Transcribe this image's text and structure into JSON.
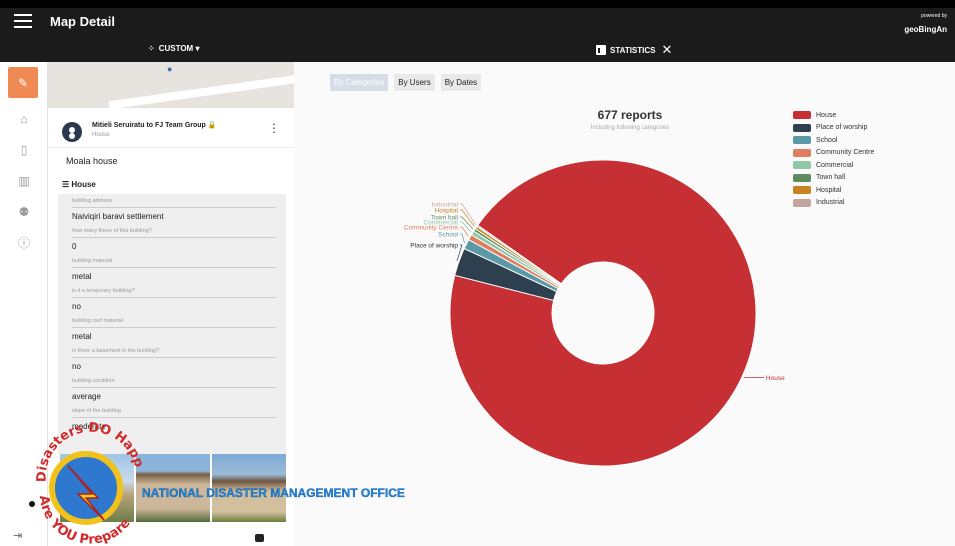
{
  "header": {
    "title": "Map Detail",
    "powered_by": "powered by",
    "brand": "geoBingAn"
  },
  "subbar": {
    "custom_label": "CUSTOM",
    "statistics_label": "STATISTICS"
  },
  "report": {
    "author": "Mitieli Seruiratu to FJ Team Group",
    "subtitle": "House",
    "title": "Moala house",
    "category": "House",
    "fields": [
      {
        "label": "building address",
        "value": "Naiviqiri baravi settlement"
      },
      {
        "label": "how many floors of this building?",
        "value": "0"
      },
      {
        "label": "building material",
        "value": "metal"
      },
      {
        "label": "is it a temporary building?",
        "value": "no"
      },
      {
        "label": "building roof material",
        "value": "metal"
      },
      {
        "label": "Is there a basement in the building?",
        "value": "no"
      },
      {
        "label": "building condition",
        "value": "average"
      },
      {
        "label": "slope of the building",
        "value": "moderate"
      }
    ]
  },
  "stats_tabs": [
    {
      "label": "By Categories",
      "active": true
    },
    {
      "label": "By Users",
      "active": false
    },
    {
      "label": "By Dates",
      "active": false
    }
  ],
  "overlay": {
    "org_name": "NATIONAL DISASTER MANAGEMENT OFFICE",
    "logo_text_top": "Disasters DO Happen",
    "logo_text_bottom": "Are YOU Prepared"
  },
  "chart_data": {
    "type": "pie",
    "title": "677 reports",
    "subtitle": "Including following categories",
    "total": 677,
    "categories": [
      "House",
      "Place of worship",
      "School",
      "Community Centre",
      "Commercial",
      "Town hall",
      "Hospital",
      "Industrial"
    ],
    "values": [
      638,
      20,
      7,
      4,
      3,
      2,
      2,
      1
    ],
    "colors": [
      "#c62f33",
      "#2e3f50",
      "#5c99a7",
      "#e07f5f",
      "#8fc7a9",
      "#5f8c5f",
      "#c9821f",
      "#c4a59e"
    ],
    "legend_position": "right"
  }
}
